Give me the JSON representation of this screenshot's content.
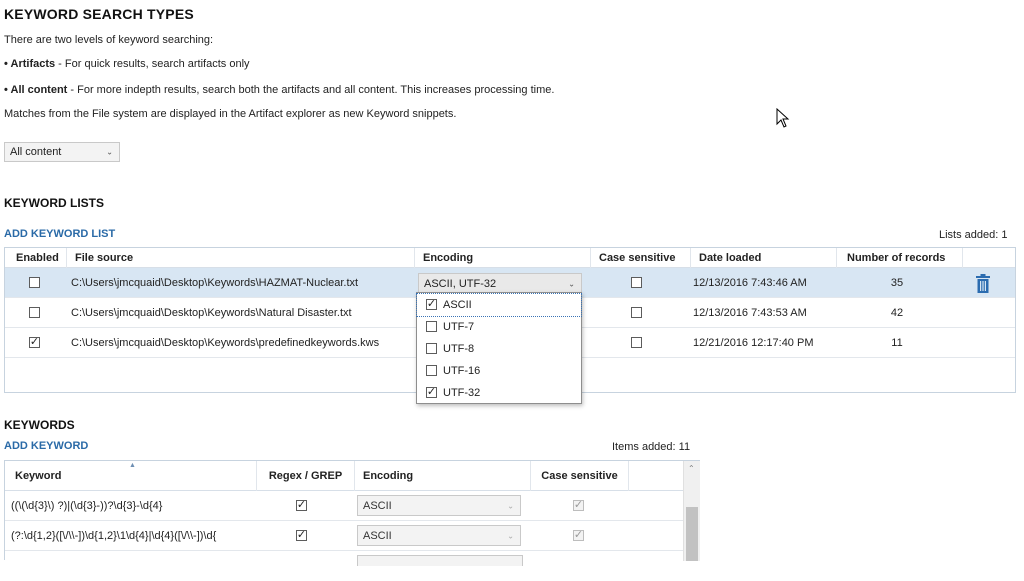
{
  "search_types": {
    "heading": "KEYWORD SEARCH TYPES",
    "intro": "There are two levels of keyword searching:",
    "artifacts_bold": "• Artifacts",
    "artifacts_rest": " - For quick results, search artifacts only",
    "all_bold": "• All content",
    "all_rest": " - For more indepth results, search both the artifacts and all content. This increases processing time.",
    "note": "Matches from the File system are displayed in the Artifact explorer as new Keyword snippets.",
    "select_value": "All content"
  },
  "keyword_lists": {
    "heading": "KEYWORD LISTS",
    "add_link": "ADD KEYWORD LIST",
    "count": "Lists added: 1",
    "columns": [
      "Enabled",
      "File source",
      "Encoding",
      "Case sensitive",
      "Date loaded",
      "Number of records"
    ],
    "rows": [
      {
        "enabled": false,
        "file": "C:\\Users\\jmcquaid\\Desktop\\Keywords\\HAZMAT-Nuclear.txt",
        "encoding": "ASCII,  UTF-32",
        "case": false,
        "date": "12/13/2016 7:43:46 AM",
        "records": "35"
      },
      {
        "enabled": false,
        "file": "C:\\Users\\jmcquaid\\Desktop\\Keywords\\Natural Disaster.txt",
        "encoding": "",
        "case": false,
        "date": "12/13/2016 7:43:53 AM",
        "records": "42"
      },
      {
        "enabled": true,
        "file": "C:\\Users\\jmcquaid\\Desktop\\Keywords\\predefinedkeywords.kws",
        "encoding": "",
        "case": false,
        "date": "12/21/2016 12:17:40 PM",
        "records": "11"
      }
    ],
    "encoding_options": [
      {
        "label": "ASCII",
        "checked": true
      },
      {
        "label": "UTF-7",
        "checked": false
      },
      {
        "label": "UTF-8",
        "checked": false
      },
      {
        "label": "UTF-16",
        "checked": false
      },
      {
        "label": "UTF-32",
        "checked": true
      }
    ]
  },
  "keywords": {
    "heading": "KEYWORDS",
    "add_link": "ADD KEYWORD",
    "count": "Items added: 11",
    "columns": [
      "Keyword",
      "Regex / GREP",
      "Encoding",
      "Case sensitive"
    ],
    "rows": [
      {
        "keyword": "((\\(\\d{3}\\) ?)|(\\d{3}-))?\\d{3}-\\d{4}",
        "regex": true,
        "encoding": "ASCII",
        "case": true
      },
      {
        "keyword": "(?:\\d{1,2}([\\/\\\\-])\\d{1,2}\\1\\d{4}|\\d{4}([\\/\\\\-])\\d{",
        "regex": true,
        "encoding": "ASCII",
        "case": true
      }
    ]
  },
  "colors": {
    "link": "#2a6aa7",
    "selected_row": "#d8e6f3",
    "trash": "#2b6cb0"
  },
  "icons": [
    "trash-icon",
    "checkbox-icon",
    "chevron-down-icon",
    "sort-arrow-icon",
    "mouse-cursor-icon"
  ]
}
